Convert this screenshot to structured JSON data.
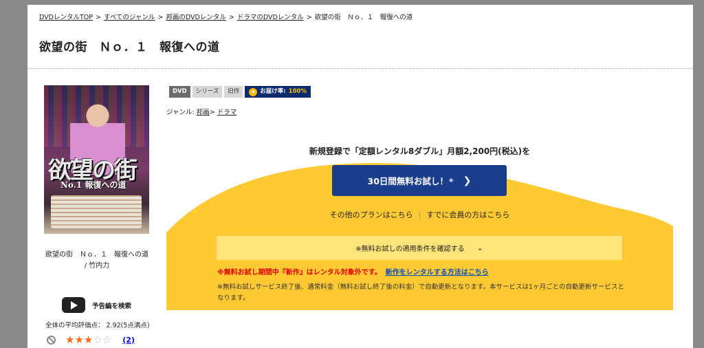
{
  "breadcrumb": [
    {
      "label": "DVDレンタルTOP"
    },
    {
      "label": "すべてのジャンル"
    },
    {
      "label": "邦画のDVDレンタル"
    },
    {
      "label": "ドラマのDVDレンタル"
    },
    {
      "label": "欲望の街　Ｎｏ．１　報復への道"
    }
  ],
  "breadcrumb_sep": ">",
  "title": "欲望の街　Ｎｏ．１　報復への道",
  "cover": {
    "logo": "欲望の街",
    "subtitle": "No.1 報復への道"
  },
  "item_name": "欲望の街　Ｎｏ．１　報復への道",
  "item_cast": "/ 竹内力",
  "trailer_label": "予告編を検索",
  "rating": {
    "text": "全体の平均評価点： 2.92(5点満点)",
    "stars_filled": 3,
    "stars_total": 5,
    "count": "(2)"
  },
  "tags": {
    "dvd": "DVD",
    "series": "シリーズ",
    "old": "旧作",
    "delivery_label": "お届け率:",
    "delivery_pct": "100%"
  },
  "genre": {
    "label": "ジャンル: ",
    "item1": "邦画",
    "sep": ">",
    "item2": "ドラマ"
  },
  "promo": {
    "headline": "新規登録で「定額レンタル8ダブル」月額2,200円(税込)を",
    "cta_label": "30日間無料お試し！",
    "cta_mark": "※",
    "link_plans": "その他のプランはこちら",
    "link_members": "すでに会員の方はこちら",
    "conditions_label": "※無料お試しの適用条件を確認する",
    "note_red": "※無料お試し期間中『新作』はレンタル対象外です。",
    "note_link": "新作をレンタルする方法はこちら",
    "note_body": "※無料お試しサービス終了後、通常料金（無料お試し終了後の料金）で自動更新となります。本サービスは1ヶ月ごとの自動更新サービスとなります。"
  },
  "colors": {
    "accent_blue": "#1a3e8c",
    "promo_yellow": "#ffc933",
    "star_orange": "#ff6a1a",
    "warning_red": "#e40000"
  }
}
